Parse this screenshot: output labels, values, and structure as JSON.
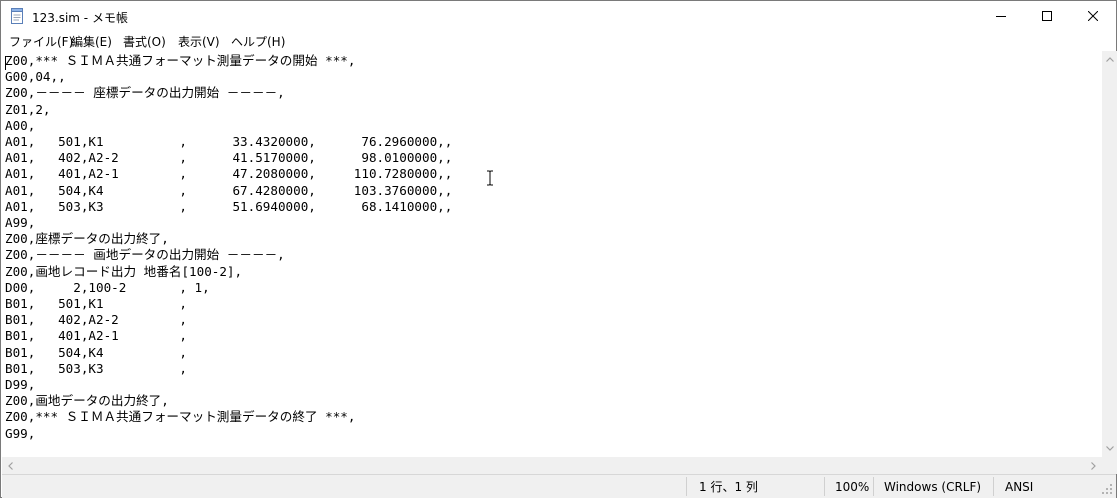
{
  "window": {
    "title": "123.sim - メモ帳",
    "icon": "notepad-icon",
    "controls": {
      "minimize_icon": "minimize-icon",
      "maximize_icon": "maximize-icon",
      "close_icon": "close-icon"
    }
  },
  "menu": {
    "items": [
      {
        "label": "ファイル(F)"
      },
      {
        "label": "編集(E)"
      },
      {
        "label": "書式(O)"
      },
      {
        "label": "表示(V)"
      },
      {
        "label": "ヘルプ(H)"
      }
    ]
  },
  "editor": {
    "content": "Z00,*** ＳＩＭＡ共通フォーマット測量データの開始 ***,\nG00,04,,\nZ00,－－－－ 座標データの出力開始 －－－－,\nZ01,2,\nA00,\nA01,   501,K1          ,      33.4320000,      76.2960000,,\nA01,   402,A2-2        ,      41.5170000,      98.0100000,,\nA01,   401,A2-1        ,      47.2080000,     110.7280000,,\nA01,   504,K4          ,      67.4280000,     103.3760000,,\nA01,   503,K3          ,      51.6940000,      68.1410000,,\nA99,\nZ00,座標データの出力終了,\nZ00,－－－－ 画地データの出力開始 －－－－,\nZ00,画地レコード出力 地番名[100-2],\nD00,     2,100-2       , 1,\nB01,   501,K1          ,\nB01,   402,A2-2        ,\nB01,   401,A2-1        ,\nB01,   504,K4          ,\nB01,   503,K3          ,\nD99,\nZ00,画地データの出力終了,\nZ00,*** ＳＩＭＡ共通フォーマット測量データの終了 ***,\nG99,"
  },
  "statusbar": {
    "position": "1 行、1 列",
    "zoom": "100%",
    "line_ending": "Windows (CRLF)",
    "encoding": "ANSI"
  }
}
